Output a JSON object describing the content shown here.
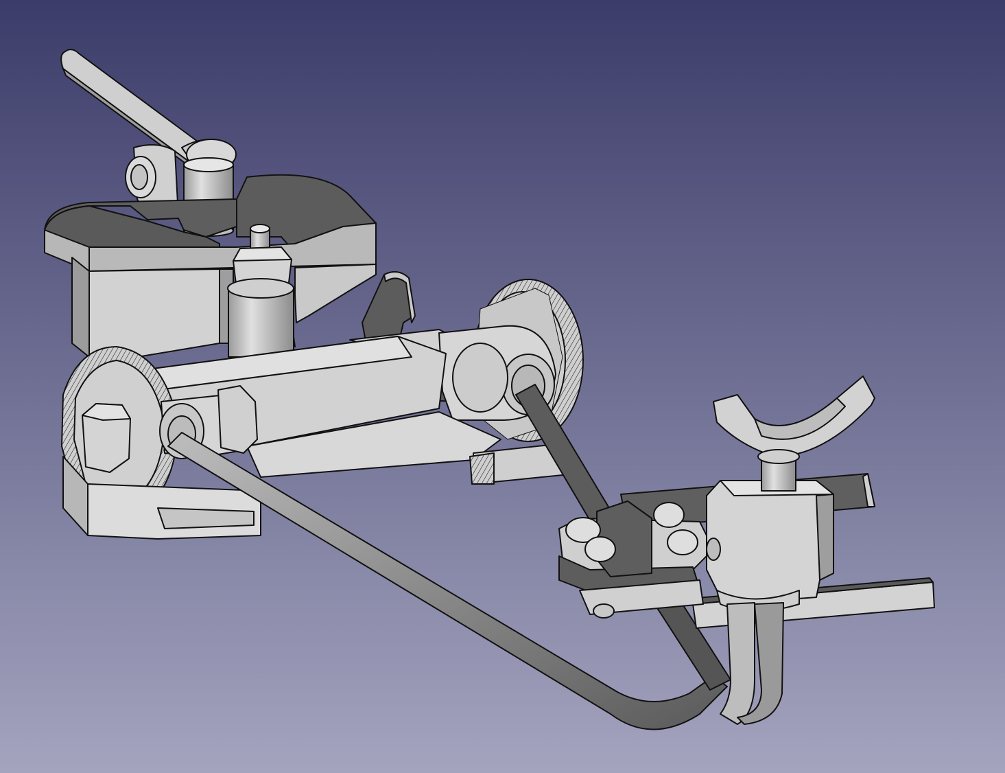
{
  "app": {
    "view": "3d-viewport"
  },
  "colors": {
    "bg_top": "#3c3c6a",
    "bg_bottom": "#a4a4bf",
    "part_light": "#d4d4d4",
    "part_mid": "#b5b5b5",
    "part_dark": "#5c5c5c",
    "part_darker": "#464646",
    "edge": "#111111"
  },
  "model": {
    "parts": [
      "lever-handle",
      "pivot-block",
      "top-cover",
      "main-housing",
      "nut-stud",
      "bracket-plate",
      "left-gear-disc",
      "right-gear-disc",
      "axle-rail",
      "left-hex-nut",
      "base-plate",
      "rod-left",
      "rod-right",
      "clamp-block",
      "fork-cradle",
      "cross-bars",
      "bent-tubes"
    ]
  }
}
